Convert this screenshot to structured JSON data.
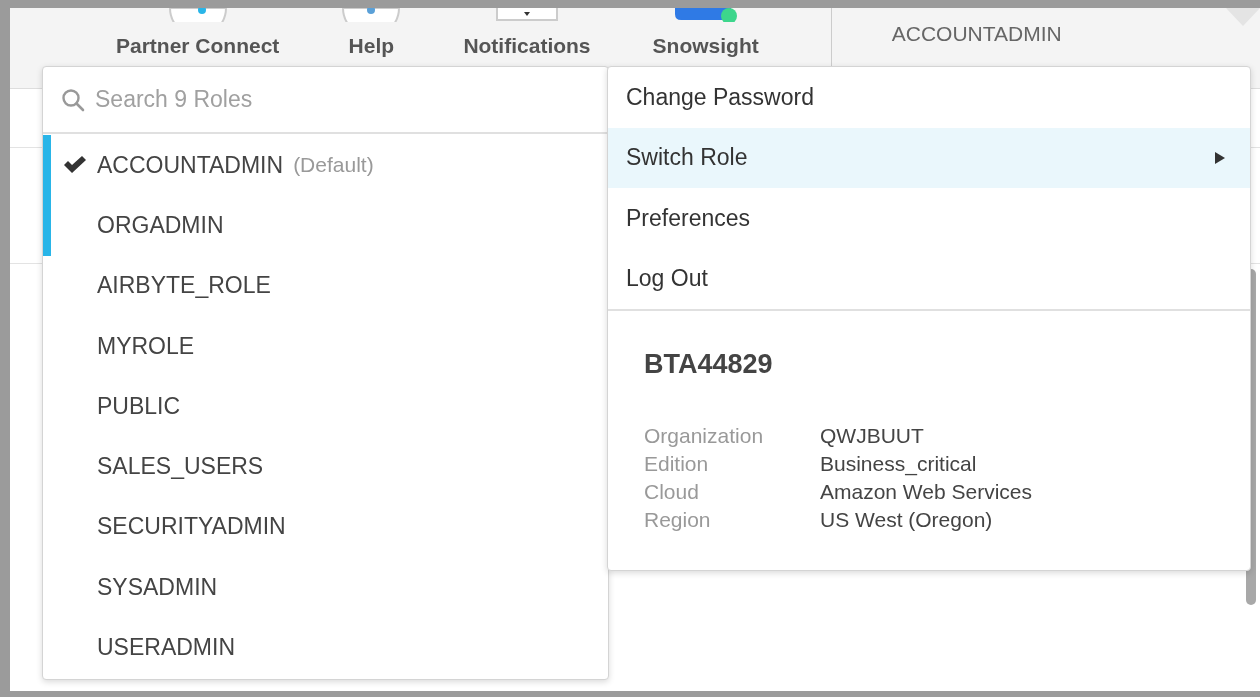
{
  "toolbar": {
    "items": [
      {
        "label": "Partner Connect",
        "kind": "circle"
      },
      {
        "label": "Help",
        "kind": "circle"
      },
      {
        "label": "Notifications",
        "kind": "tray"
      },
      {
        "label": "Snowsight",
        "kind": "pill"
      }
    ],
    "user": {
      "role": "ACCOUNTADMIN"
    }
  },
  "role_menu": {
    "search": {
      "placeholder": "Search 9 Roles"
    },
    "roles": [
      {
        "name": "ACCOUNTADMIN",
        "note": "(Default)",
        "selected": true,
        "highlighted": true
      },
      {
        "name": "ORGADMIN",
        "selected": false,
        "highlighted": true
      },
      {
        "name": "AIRBYTE_ROLE",
        "selected": false,
        "highlighted": false
      },
      {
        "name": "MYROLE",
        "selected": false,
        "highlighted": false
      },
      {
        "name": "PUBLIC",
        "selected": false,
        "highlighted": false
      },
      {
        "name": "SALES_USERS",
        "selected": false,
        "highlighted": false
      },
      {
        "name": "SECURITYADMIN",
        "selected": false,
        "highlighted": false
      },
      {
        "name": "SYSADMIN",
        "selected": false,
        "highlighted": false
      },
      {
        "name": "USERADMIN",
        "selected": false,
        "highlighted": false
      }
    ]
  },
  "user_menu": {
    "items": [
      {
        "label": "Change Password",
        "highlighted": false,
        "submenu": false
      },
      {
        "label": "Switch Role",
        "highlighted": true,
        "submenu": true
      },
      {
        "label": "Preferences",
        "highlighted": false,
        "submenu": false
      },
      {
        "label": "Log Out",
        "highlighted": false,
        "submenu": false
      }
    ],
    "account": {
      "name": "BTA44829",
      "details": [
        {
          "label": "Organization",
          "value": "QWJBUUT"
        },
        {
          "label": "Edition",
          "value": "Business_critical"
        },
        {
          "label": "Cloud",
          "value": "Amazon Web Services"
        },
        {
          "label": "Region",
          "value": "US West (Oregon)"
        }
      ]
    }
  }
}
